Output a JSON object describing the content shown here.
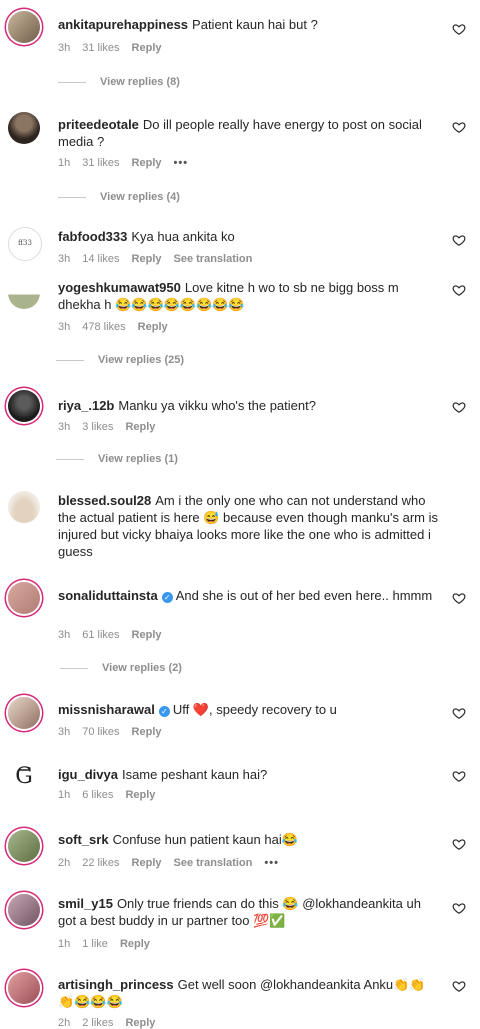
{
  "comments": [
    {
      "user": "ankitapurehappiness",
      "verified": false,
      "text": "Patient kaun hai but ?",
      "time": "3h",
      "likes": "31 likes",
      "reply": "Reply",
      "view_replies": "View replies (8)"
    },
    {
      "user": "priteedeotale",
      "verified": false,
      "text": "Do ill people really have energy to post on social media ?",
      "time": "1h",
      "likes": "31 likes",
      "reply": "Reply",
      "more": "•••",
      "view_replies": "View replies (4)"
    },
    {
      "user": "fabfood333",
      "verified": false,
      "text": "Kya hua ankita ko",
      "time": "3h",
      "likes": "14 likes",
      "reply": "Reply",
      "see_translation": "See translation"
    },
    {
      "user": "yogeshkumawat950",
      "verified": false,
      "text": "Love kitne h wo to sb ne bigg boss m dhekha h 😂😂😂😂😂😂😂😂",
      "time": "3h",
      "likes": "478 likes",
      "reply": "Reply",
      "view_replies": "View replies (25)"
    },
    {
      "user": "riya_.12b",
      "verified": false,
      "text": "Manku ya vikku who's the patient?",
      "time": "3h",
      "likes": "3 likes",
      "reply": "Reply",
      "view_replies": "View replies (1)"
    },
    {
      "user": "blessed.soul28",
      "verified": false,
      "text": "Am i the only one who can not understand who the actual patient is here 😅 because even though manku's arm is injured but vicky bhaiya looks more like the one who is admitted i guess"
    },
    {
      "user": "sonaliduttainsta",
      "verified": true,
      "text": "And she is out of her bed even here.. hmmm",
      "time": "3h",
      "likes": "61 likes",
      "reply": "Reply",
      "view_replies": "View replies (2)"
    },
    {
      "user": "missnisharawal",
      "verified": true,
      "text": "Uff ❤️, speedy recovery to u",
      "time": "3h",
      "likes": "70 likes",
      "reply": "Reply"
    },
    {
      "user": "igu_divya",
      "verified": false,
      "text": "Isame peshant kaun hai?",
      "time": "1h",
      "likes": "6 likes",
      "reply": "Reply"
    },
    {
      "user": "soft_srk",
      "verified": false,
      "text": "Confuse hun patient kaun hai😂",
      "time": "2h",
      "likes": "22 likes",
      "reply": "Reply",
      "see_translation": "See translation",
      "more": "•••"
    },
    {
      "user": "smil_y15",
      "verified": false,
      "text": "Only true friends can do this 😂 @lokhandeankita uh got a best buddy in ur partner too 💯✅",
      "time": "1h",
      "likes": "1 like",
      "reply": "Reply"
    },
    {
      "user": "artisingh_princess",
      "verified": false,
      "text": "Get well soon @lokhandeankita Anku👏👏 👏😂😂😂",
      "time": "2h",
      "likes": "2 likes",
      "reply": "Reply"
    }
  ],
  "icons": {
    "like": "heart-outline-icon",
    "verified": "verified-badge-icon"
  },
  "colors": {
    "text": "#262626",
    "secondary": "#8e8e8e",
    "story_ring": "#d62976",
    "verified": "#3897f0"
  }
}
